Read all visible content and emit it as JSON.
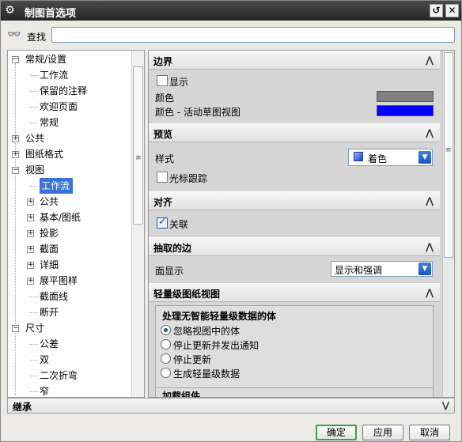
{
  "window": {
    "title": "制图首选项",
    "app_icon": "gear-icon",
    "controls": [
      "reset-icon",
      "close-icon"
    ]
  },
  "search": {
    "label": "查找",
    "value": "",
    "placeholder": "",
    "icon": "binoculars-icon"
  },
  "tree": {
    "items": [
      {
        "label": "常规/设置",
        "level": 0,
        "expander": "minus"
      },
      {
        "label": "工作流",
        "level": 1
      },
      {
        "label": "保留的注释",
        "level": 1
      },
      {
        "label": "欢迎页面",
        "level": 1
      },
      {
        "label": "常规",
        "level": 1
      },
      {
        "label": "公共",
        "level": 0,
        "expander": "plus"
      },
      {
        "label": "图纸格式",
        "level": 0,
        "expander": "plus"
      },
      {
        "label": "视图",
        "level": 0,
        "expander": "minus"
      },
      {
        "label": "工作流",
        "level": 1,
        "selected": true
      },
      {
        "label": "公共",
        "level": 1,
        "expander": "plus"
      },
      {
        "label": "基本/图纸",
        "level": 1,
        "expander": "plus"
      },
      {
        "label": "投影",
        "level": 1,
        "expander": "plus"
      },
      {
        "label": "截面",
        "level": 1,
        "expander": "plus"
      },
      {
        "label": "详细",
        "level": 1,
        "expander": "plus"
      },
      {
        "label": "展平图样",
        "level": 1,
        "expander": "plus"
      },
      {
        "label": "截面线",
        "level": 1
      },
      {
        "label": "断开",
        "level": 1
      },
      {
        "label": "尺寸",
        "level": 0,
        "expander": "minus"
      },
      {
        "label": "公差",
        "level": 1
      },
      {
        "label": "双",
        "level": 1
      },
      {
        "label": "二次折弯",
        "level": 1
      },
      {
        "label": "窄",
        "level": 1
      }
    ]
  },
  "sections": {
    "border": {
      "title": "边界",
      "show_label": "显示",
      "show_checked": false,
      "color_label": "颜色",
      "color_value": "#808080",
      "active_color_label": "颜色 - 活动草图视图",
      "active_color_value": "#0000ff"
    },
    "preview": {
      "title": "预览",
      "style_label": "样式",
      "style_value": "着色",
      "cursor_label": "光标跟踪",
      "cursor_checked": false
    },
    "align": {
      "title": "对齐",
      "associative_label": "关联",
      "associative_checked": true
    },
    "extracted_edges": {
      "title": "抽取的边",
      "face_label": "面显示",
      "face_value": "显示和强调"
    },
    "lightweight": {
      "title": "轻量级图纸视图",
      "group_title": "处理无智能轻量级数据的体",
      "options": [
        "忽略视图中的体",
        "停止更新并发出通知",
        "停止更新",
        "生成轻量级数据"
      ],
      "selected": 0,
      "next_group_title": "加载组件"
    }
  },
  "inherit": {
    "label": "继承"
  },
  "buttons": {
    "ok": "确定",
    "apply": "应用",
    "cancel": "取消"
  }
}
